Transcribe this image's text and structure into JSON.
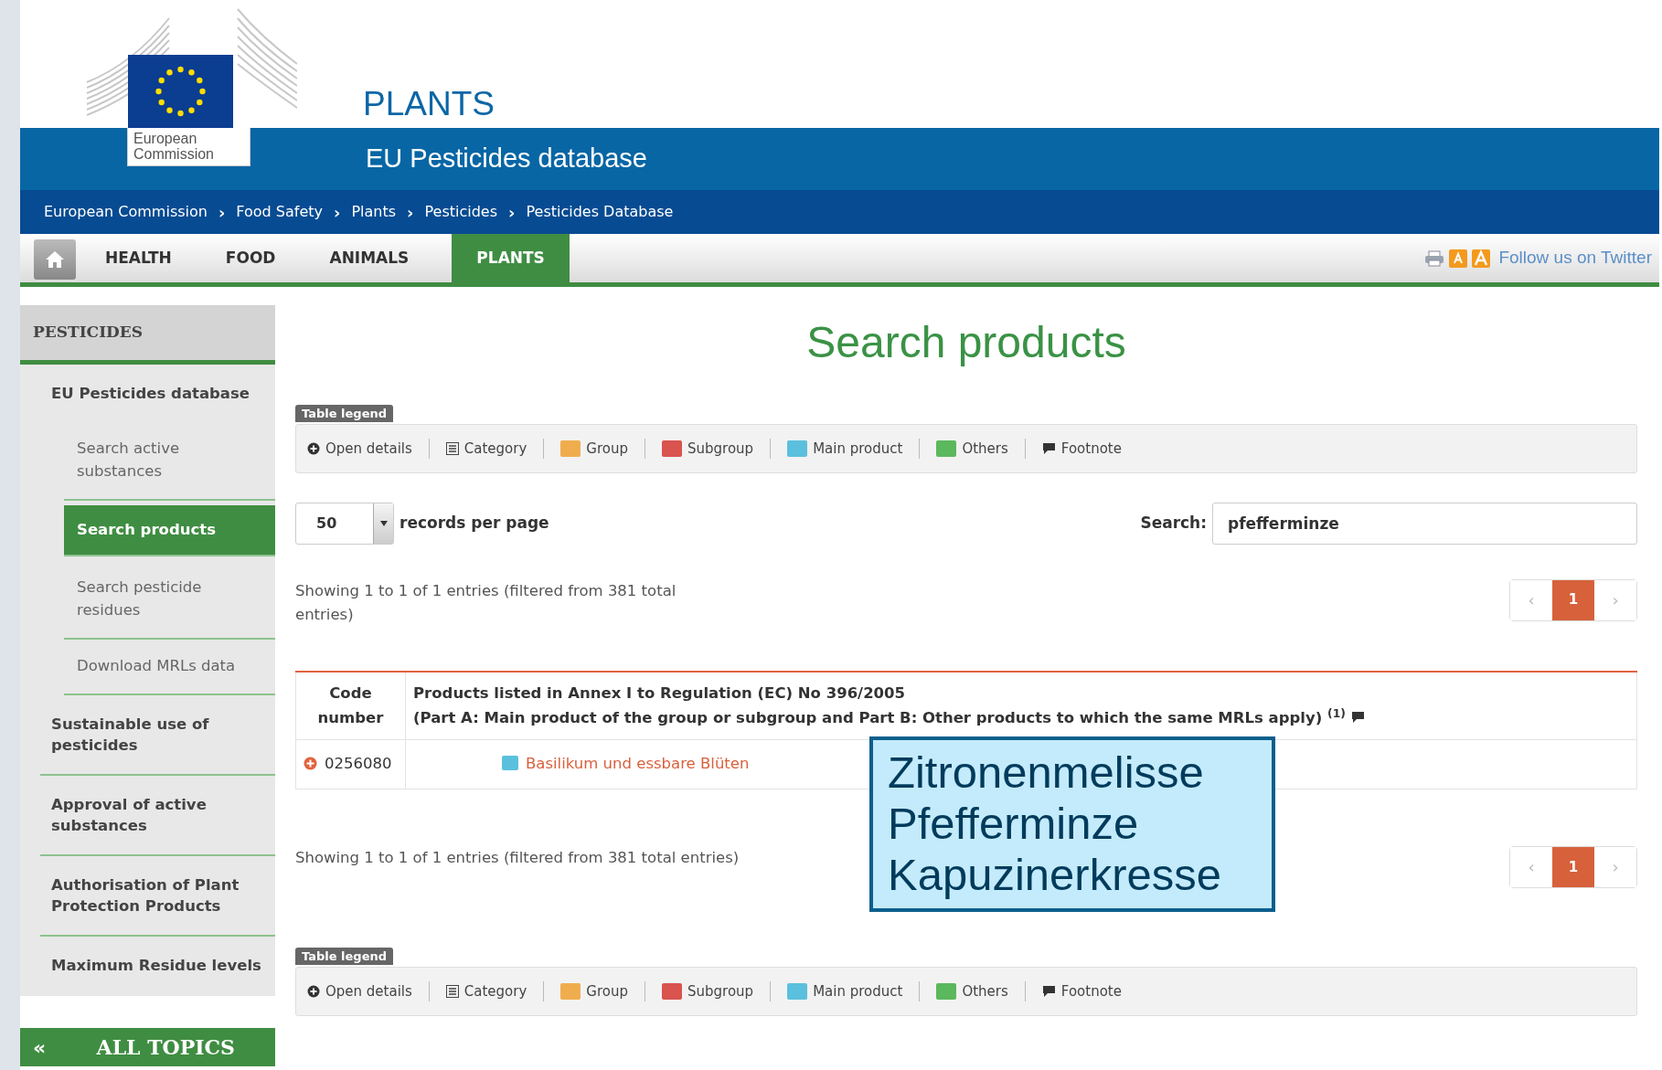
{
  "header": {
    "logo_text": "European Commission",
    "site_title": "PLANTS",
    "subtitle": "EU Pesticides database"
  },
  "breadcrumb": [
    {
      "label": "European Commission"
    },
    {
      "label": "Food Safety"
    },
    {
      "label": "Plants"
    },
    {
      "label": "Pesticides"
    },
    {
      "label": "Pesticides Database"
    }
  ],
  "breadcrumb_separator": "›",
  "nav": {
    "tabs": [
      {
        "label": "HEALTH",
        "selected": false
      },
      {
        "label": "FOOD",
        "selected": false
      },
      {
        "label": "ANIMALS",
        "selected": false
      },
      {
        "label": "PLANTS",
        "selected": true
      }
    ],
    "follow_link": "Follow us on Twitter"
  },
  "sidebar": {
    "title": "PESTICIDES",
    "items": [
      {
        "label": "EU Pesticides database",
        "selected": false,
        "children": [
          {
            "label": "Search active substances",
            "selected": false
          },
          {
            "label": "Search products",
            "selected": true
          },
          {
            "label": "Search pesticide residues",
            "selected": false
          },
          {
            "label": "Download MRLs data",
            "selected": false
          }
        ]
      },
      {
        "label": "Sustainable use of pesticides",
        "selected": false
      },
      {
        "label": "Approval of active substances",
        "selected": false
      },
      {
        "label": "Authorisation of Plant Protection Products",
        "selected": false
      },
      {
        "label": "Maximum Residue levels",
        "selected": false
      }
    ],
    "all_topics": {
      "arrow": "«",
      "label": "ALL TOPICS"
    }
  },
  "main": {
    "title": "Search products",
    "legend_top": {
      "title": "Table legend",
      "items": [
        {
          "kind": "open",
          "label": "Open details"
        },
        {
          "kind": "category",
          "label": "Category"
        },
        {
          "kind": "swatch",
          "label": "Group",
          "color": "#f0ad4e"
        },
        {
          "kind": "swatch",
          "label": "Subgroup",
          "color": "#d9534f"
        },
        {
          "kind": "swatch",
          "label": "Main product",
          "color": "#5bc0de"
        },
        {
          "kind": "swatch",
          "label": "Others",
          "color": "#5cb85c"
        },
        {
          "kind": "footnote",
          "label": "Footnote"
        }
      ]
    },
    "length": {
      "value": "50",
      "label": "records per page"
    },
    "search": {
      "label": "Search:",
      "value": "pfefferminze"
    },
    "info_top": "Showing 1 to 1 of 1 entries (filtered from 381 total entries)",
    "pagination_top": {
      "prev": "‹",
      "next": "›",
      "pages": [
        {
          "label": "1",
          "selected": true
        }
      ]
    },
    "table": {
      "columns": [
        {
          "label": "Code number"
        },
        {
          "label": "Products listed in Annex I to Regulation (EC) No 396/2005\n(Part A: Main product of the group or subgroup and Part B: Other products to which the same MRLs apply) $^{(1)}$",
          "footnote": true
        }
      ],
      "rows": [
        {
          "code": "0256080",
          "product": "Basilikum und essbare Blüten",
          "color": "#5bc0de"
        }
      ]
    },
    "info_bottom": "Showing 1 to 1 of 1 entries (filtered from 381 total entries)",
    "pagination_bottom": {
      "prev": "‹",
      "next": "›",
      "pages": [
        {
          "label": "1",
          "selected": true
        }
      ]
    },
    "legend_bottom": {
      "title": "Table legend",
      "items": [
        {
          "kind": "open",
          "label": "Open details"
        },
        {
          "kind": "category",
          "label": "Category"
        },
        {
          "kind": "swatch",
          "label": "Group",
          "color": "#f0ad4e"
        },
        {
          "kind": "swatch",
          "label": "Subgroup",
          "color": "#d9534f"
        },
        {
          "kind": "swatch",
          "label": "Main product",
          "color": "#5bc0de"
        },
        {
          "kind": "swatch",
          "label": "Others",
          "color": "#5cb85c"
        },
        {
          "kind": "footnote",
          "label": "Footnote"
        }
      ]
    }
  },
  "callout": {
    "lines": [
      "Zitronenmelisse",
      "Pfefferminze",
      "Kapuzinerkresse"
    ]
  }
}
